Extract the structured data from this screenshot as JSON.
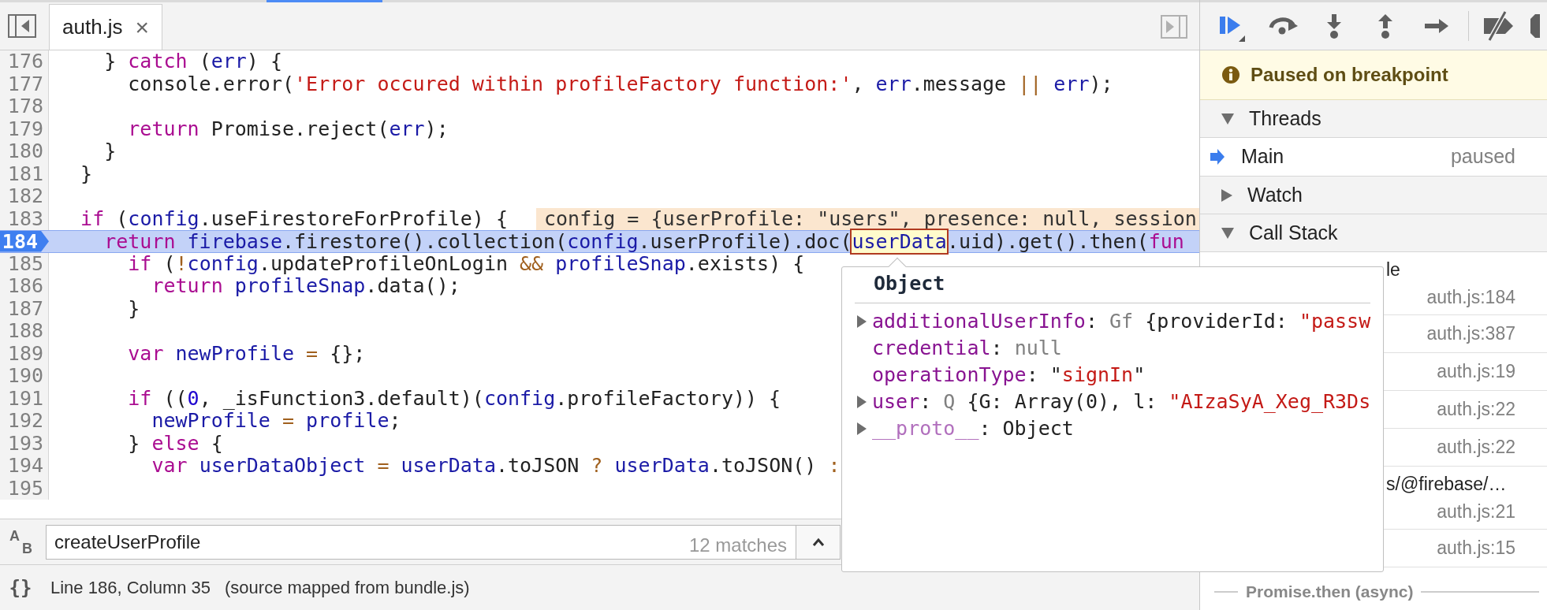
{
  "editor": {
    "tabs": [
      {
        "label": "auth.js",
        "close": "×",
        "selected": true
      }
    ],
    "lines": [
      {
        "number": "176",
        "current": false,
        "tokens": [
          {
            "kind": "plain",
            "text": "    } "
          },
          {
            "kind": "keyword",
            "text": "catch"
          },
          {
            "kind": "plain",
            "text": " ("
          },
          {
            "kind": "variable",
            "text": "err"
          },
          {
            "kind": "plain",
            "text": ") {"
          }
        ]
      },
      {
        "number": "177",
        "current": false,
        "tokens": [
          {
            "kind": "plain",
            "text": "      console.error("
          },
          {
            "kind": "string",
            "text": "'Error occured within profileFactory function:'"
          },
          {
            "kind": "plain",
            "text": ", "
          },
          {
            "kind": "variable",
            "text": "err"
          },
          {
            "kind": "plain",
            "text": ".message "
          },
          {
            "kind": "operator",
            "text": "||"
          },
          {
            "kind": "variable",
            "text": " err"
          },
          {
            "kind": "plain",
            "text": ");"
          }
        ]
      },
      {
        "number": "178",
        "current": false
      },
      {
        "number": "179",
        "current": false,
        "tokens": [
          {
            "kind": "keyword",
            "text": "      return"
          },
          {
            "kind": "plain",
            "text": " Promise.reject("
          },
          {
            "kind": "variable",
            "text": "err"
          },
          {
            "kind": "plain",
            "text": ");"
          }
        ]
      },
      {
        "number": "180",
        "current": false,
        "tokens": [
          {
            "kind": "plain",
            "text": "    }"
          }
        ]
      },
      {
        "number": "181",
        "current": false,
        "tokens": [
          {
            "kind": "plain",
            "text": "  }"
          }
        ]
      },
      {
        "number": "182",
        "current": false
      },
      {
        "number": "183",
        "current": false,
        "tokens": [
          {
            "kind": "keyword",
            "text": "  if"
          },
          {
            "kind": "plain",
            "text": " ("
          },
          {
            "kind": "variable",
            "text": "config"
          },
          {
            "kind": "plain",
            "text": ".useFirestoreForProfile) {"
          }
        ],
        "inline_value": "config = {userProfile: \"users\", presence: null, session"
      },
      {
        "number": "184",
        "current": true,
        "tokens": [
          {
            "kind": "keyword",
            "text": "    return"
          },
          {
            "kind": "variable",
            "text": " firebase"
          },
          {
            "kind": "plain",
            "text": ".firestore().collection("
          },
          {
            "kind": "variable",
            "text": "config"
          },
          {
            "kind": "plain",
            "text": ".userProfile).doc("
          },
          {
            "kind": "hovered",
            "text": "userData"
          },
          {
            "kind": "plain",
            "text": ".uid).get().then("
          },
          {
            "kind": "keyword",
            "text": "fun"
          }
        ]
      },
      {
        "number": "185",
        "current": false,
        "tokens": [
          {
            "kind": "keyword",
            "text": "      if"
          },
          {
            "kind": "plain",
            "text": " ("
          },
          {
            "kind": "operator",
            "text": "!"
          },
          {
            "kind": "variable",
            "text": "config"
          },
          {
            "kind": "plain",
            "text": ".updateProfileOnLogin "
          },
          {
            "kind": "operator",
            "text": "&&"
          },
          {
            "kind": "variable",
            "text": " profileSnap"
          },
          {
            "kind": "plain",
            "text": ".exists) {"
          }
        ]
      },
      {
        "number": "186",
        "current": false,
        "tokens": [
          {
            "kind": "keyword",
            "text": "        return"
          },
          {
            "kind": "variable",
            "text": " profileSnap"
          },
          {
            "kind": "plain",
            "text": ".data();"
          }
        ]
      },
      {
        "number": "187",
        "current": false,
        "tokens": [
          {
            "kind": "plain",
            "text": "      }"
          }
        ]
      },
      {
        "number": "188",
        "current": false
      },
      {
        "number": "189",
        "current": false,
        "tokens": [
          {
            "kind": "keyword",
            "text": "      var"
          },
          {
            "kind": "variable",
            "text": " newProfile"
          },
          {
            "kind": "operator",
            "text": " ="
          },
          {
            "kind": "plain",
            "text": " {};"
          }
        ]
      },
      {
        "number": "190",
        "current": false
      },
      {
        "number": "191",
        "current": false,
        "tokens": [
          {
            "kind": "keyword",
            "text": "      if"
          },
          {
            "kind": "plain",
            "text": " (("
          },
          {
            "kind": "number",
            "text": "0"
          },
          {
            "kind": "plain",
            "text": ", _isFunction3.default)("
          },
          {
            "kind": "variable",
            "text": "config"
          },
          {
            "kind": "plain",
            "text": ".profileFactory)) {"
          }
        ]
      },
      {
        "number": "192",
        "current": false,
        "tokens": [
          {
            "kind": "variable",
            "text": "        newProfile"
          },
          {
            "kind": "operator",
            "text": " ="
          },
          {
            "kind": "variable",
            "text": " profile"
          },
          {
            "kind": "plain",
            "text": ";"
          }
        ]
      },
      {
        "number": "193",
        "current": false,
        "tokens": [
          {
            "kind": "plain",
            "text": "      } "
          },
          {
            "kind": "keyword",
            "text": "else"
          },
          {
            "kind": "plain",
            "text": " {"
          }
        ]
      },
      {
        "number": "194",
        "current": false,
        "tokens": [
          {
            "kind": "keyword",
            "text": "        var"
          },
          {
            "kind": "variable",
            "text": " userDataObject"
          },
          {
            "kind": "operator",
            "text": " ="
          },
          {
            "kind": "variable",
            "text": " userData"
          },
          {
            "kind": "plain",
            "text": ".toJSON "
          },
          {
            "kind": "operator",
            "text": "?"
          },
          {
            "kind": "variable",
            "text": " userData"
          },
          {
            "kind": "plain",
            "text": ".toJSON() "
          },
          {
            "kind": "operator",
            "text": ":"
          }
        ]
      },
      {
        "number": "195",
        "current": false
      }
    ],
    "search": {
      "replace_toggle": {
        "from": "A",
        "to": "B"
      },
      "query": "createUserProfile",
      "matches": "12 matches"
    },
    "status_bar": {
      "pretty_print": "{}",
      "position": "Line 186, Column 35",
      "source_map": "(source mapped from bundle.js)"
    }
  },
  "popover": {
    "title": "Object",
    "properties": [
      {
        "expandable": true,
        "tokens": [
          {
            "kind": "key",
            "text": "additionalUserInfo"
          },
          {
            "kind": "plain",
            "text": ": "
          },
          {
            "kind": "type",
            "text": "Gf"
          },
          {
            "kind": "plain",
            "text": " {providerId: "
          },
          {
            "kind": "string",
            "text": "\"passw"
          }
        ]
      },
      {
        "expandable": false,
        "tokens": [
          {
            "kind": "key",
            "text": "credential"
          },
          {
            "kind": "plain",
            "text": ": "
          },
          {
            "kind": "type",
            "text": "null"
          }
        ]
      },
      {
        "expandable": false,
        "tokens": [
          {
            "kind": "key",
            "text": "operationType"
          },
          {
            "kind": "plain",
            "text": ": \""
          },
          {
            "kind": "string",
            "text": "signIn"
          },
          {
            "kind": "plain",
            "text": "\""
          }
        ]
      },
      {
        "expandable": true,
        "tokens": [
          {
            "kind": "key",
            "text": "user"
          },
          {
            "kind": "plain",
            "text": ": "
          },
          {
            "kind": "type",
            "text": "Q"
          },
          {
            "kind": "plain",
            "text": " {G: Array(0), l: "
          },
          {
            "kind": "string",
            "text": "\"AIzaSyA_Xeg_R3Ds"
          }
        ]
      },
      {
        "expandable": true,
        "tokens": [
          {
            "kind": "proto",
            "text": "__proto__"
          },
          {
            "kind": "plain",
            "text": ": Object"
          }
        ]
      }
    ]
  },
  "debugger": {
    "banner": "Paused on breakpoint",
    "sections": [
      {
        "title": "Threads",
        "expanded": true,
        "threads": [
          {
            "name": "Main",
            "status": "paused",
            "current": true
          }
        ]
      },
      {
        "title": "Watch",
        "expanded": false
      },
      {
        "title": "Call Stack",
        "expanded": true,
        "frames": [
          {
            "name": "le",
            "location": "auth.js:184"
          },
          {
            "location": "auth.js:387"
          },
          {
            "location": "auth.js:19"
          },
          {
            "location": "auth.js:22"
          },
          {
            "location": "auth.js:22"
          },
          {
            "name": "s/@firebase/…",
            "location": "auth.js:21"
          },
          {
            "location": "auth.js:15"
          }
        ],
        "async_label": "Promise.then (async)"
      }
    ]
  }
}
